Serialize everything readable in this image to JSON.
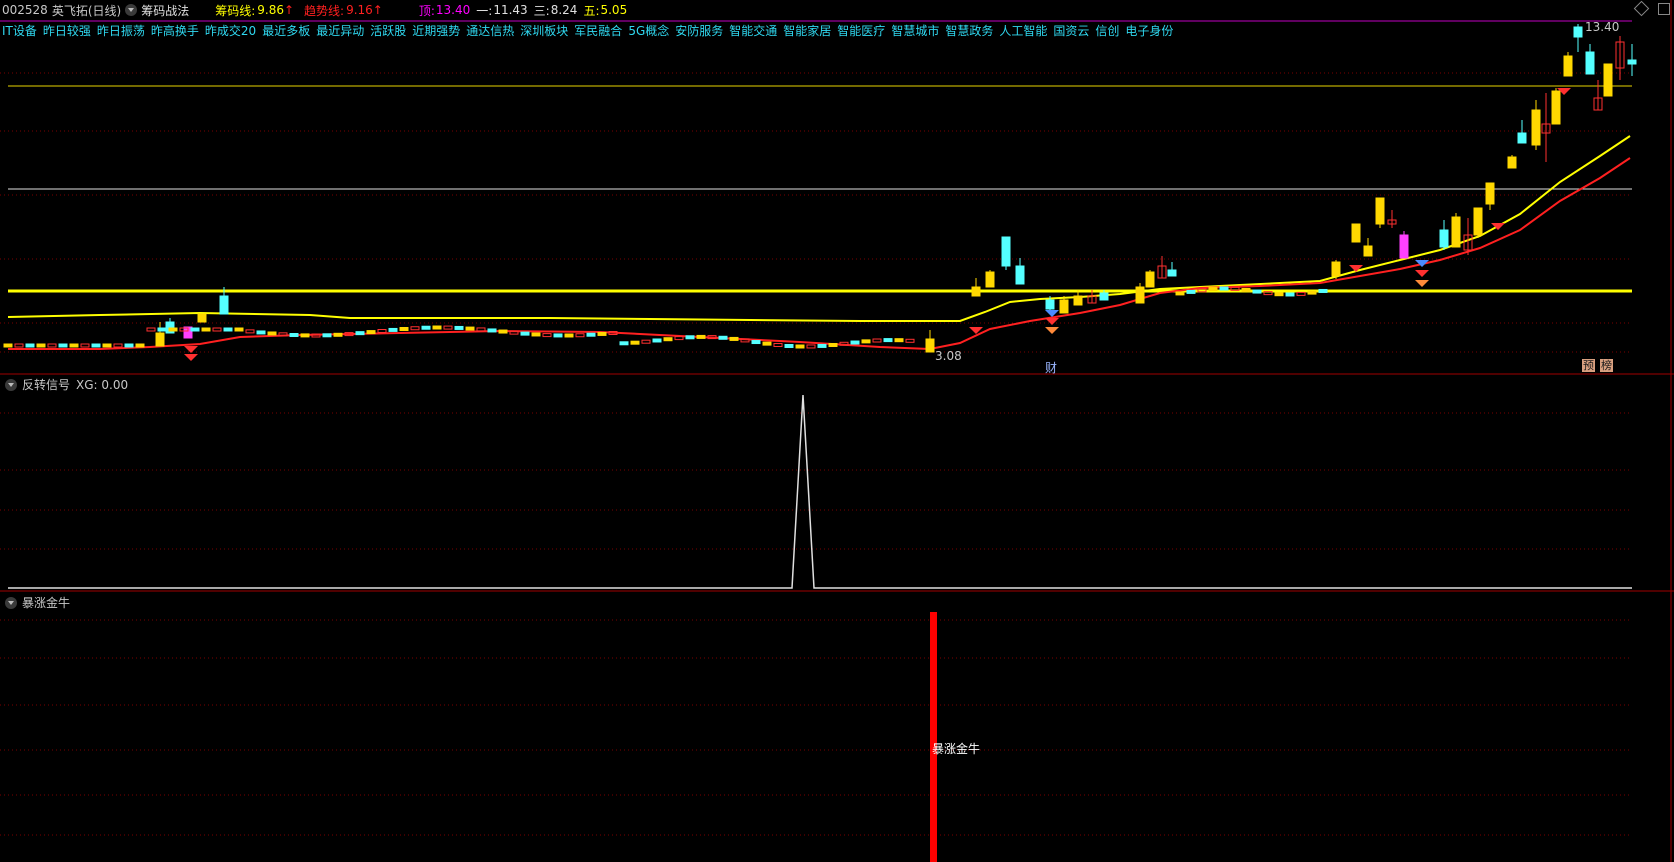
{
  "header": {
    "code": "002528",
    "name": "英飞拓(日线)",
    "indicator": "筹码战法",
    "chip_line_label": "筹码线:",
    "chip_line_value": "9.86",
    "trend_line_label": "趋势线:",
    "trend_line_value": "9.16",
    "top_label": "顶:",
    "top_value": "13.40",
    "one_label": "一:",
    "one_value": "11.43",
    "three_label": "三:",
    "three_value": "8.24",
    "five_label": "五:",
    "five_value": "5.05"
  },
  "tags": [
    "IT设备",
    "昨日较强",
    "昨日振荡",
    "昨高换手",
    "昨成交20",
    "最近多板",
    "最近异动",
    "活跃股",
    "近期强势",
    "通达信热",
    "深圳板块",
    "军民融合",
    "5G概念",
    "安防服务",
    "智能交通",
    "智能家居",
    "智能医疗",
    "智慧城市",
    "智慧政务",
    "人工智能",
    "国资云",
    "信创",
    "电子身份"
  ],
  "main_chart": {
    "high_label": "13.40",
    "low_label": "3.08",
    "marker_cai": "财",
    "marker_yu": "预",
    "marker_bang": "榜"
  },
  "panel2": {
    "title": "反转信号",
    "xg_label": "XG: 0.00"
  },
  "panel3": {
    "title": "暴涨金牛",
    "bar_label": "暴涨金牛"
  },
  "colors": {
    "yellow": "#ffff00",
    "red": "#ff2020",
    "cyan": "#54ffff",
    "magenta": "#ff00ff",
    "grid": "#7a0000",
    "separator": "#a00000"
  }
}
